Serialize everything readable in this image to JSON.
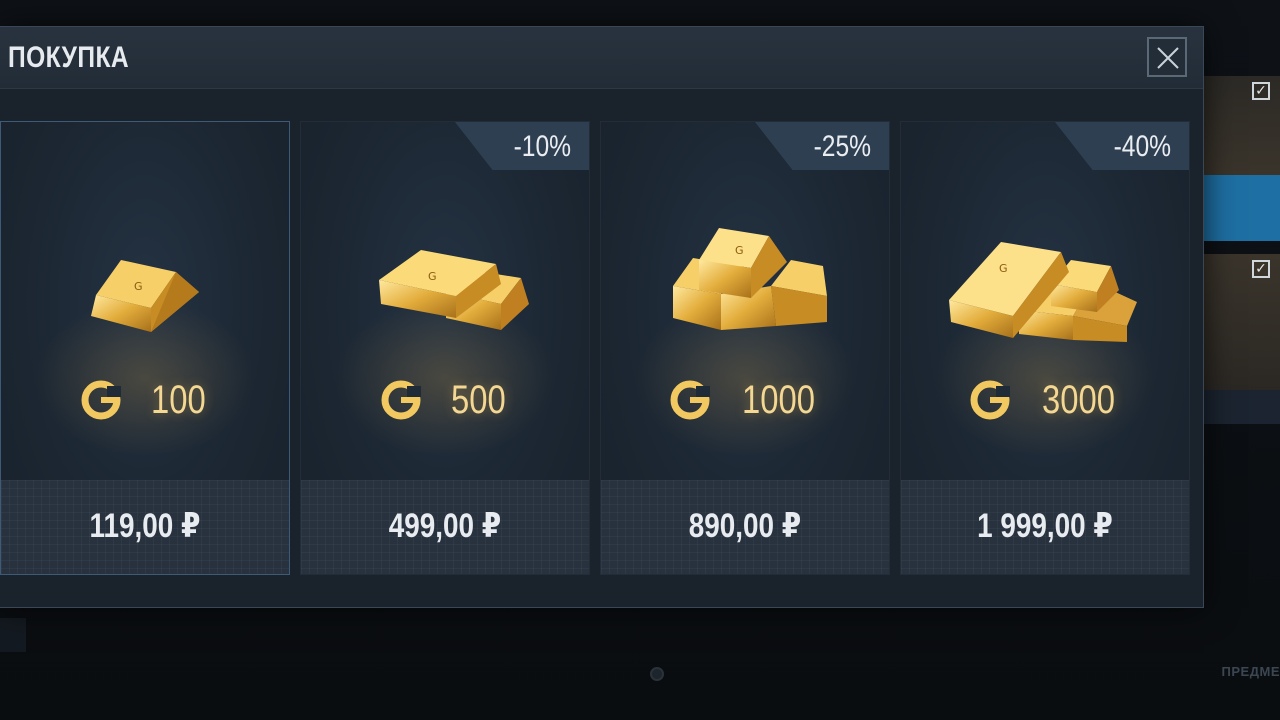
{
  "modal": {
    "title": "ПОКУПКА"
  },
  "offers": [
    {
      "amount": "100",
      "price": "119,00 ₽",
      "discount": ""
    },
    {
      "amount": "500",
      "price": "499,00 ₽",
      "discount": "-10%"
    },
    {
      "amount": "1000",
      "price": "890,00 ₽",
      "discount": "-25%"
    },
    {
      "amount": "3000",
      "price": "1 999,00 ₽",
      "discount": "-40%"
    }
  ],
  "background": {
    "footer_text": "ПРЕДМЕ"
  },
  "colors": {
    "gold": "#f3d792",
    "panel": "#1a222c",
    "discount_badge": "#2f3f52"
  },
  "icons": [
    "close-icon",
    "gold-currency-icon",
    "gold-bar-icon",
    "checkbox-icon"
  ]
}
